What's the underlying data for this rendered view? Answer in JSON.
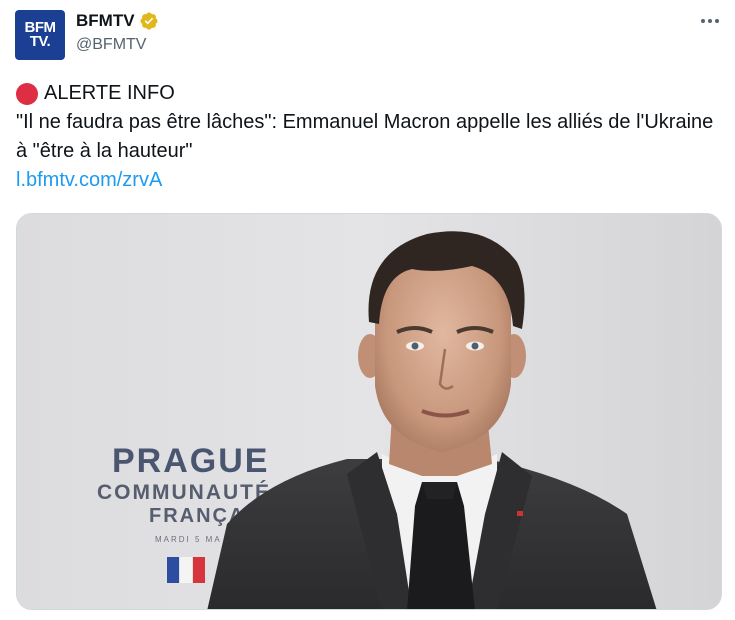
{
  "account": {
    "display_name": "BFMTV",
    "handle": "@BFMTV",
    "avatar_text_line1": "BFM",
    "avatar_text_line2": "TV.",
    "verified_icon": "verified-gold-check"
  },
  "post": {
    "alert_label": "ALERTE INFO",
    "headline": "\"Il ne faudra pas être lâches\": Emmanuel Macron appelle les alliés de l'Ukraine à \"être à la hauteur\"",
    "link_text": "l.bfmtv.com/zrvA"
  },
  "media": {
    "backdrop_line1": "PRAGUE",
    "backdrop_line2": "COMMUNAUTÉ",
    "backdrop_line3": "FRANÇA",
    "backdrop_line4": "MARDI 5 MA"
  },
  "colors": {
    "link": "#1d9bf0",
    "alert_dot": "#dd2e44",
    "avatar_bg": "#1a3f93",
    "verified": "#e2b719"
  }
}
